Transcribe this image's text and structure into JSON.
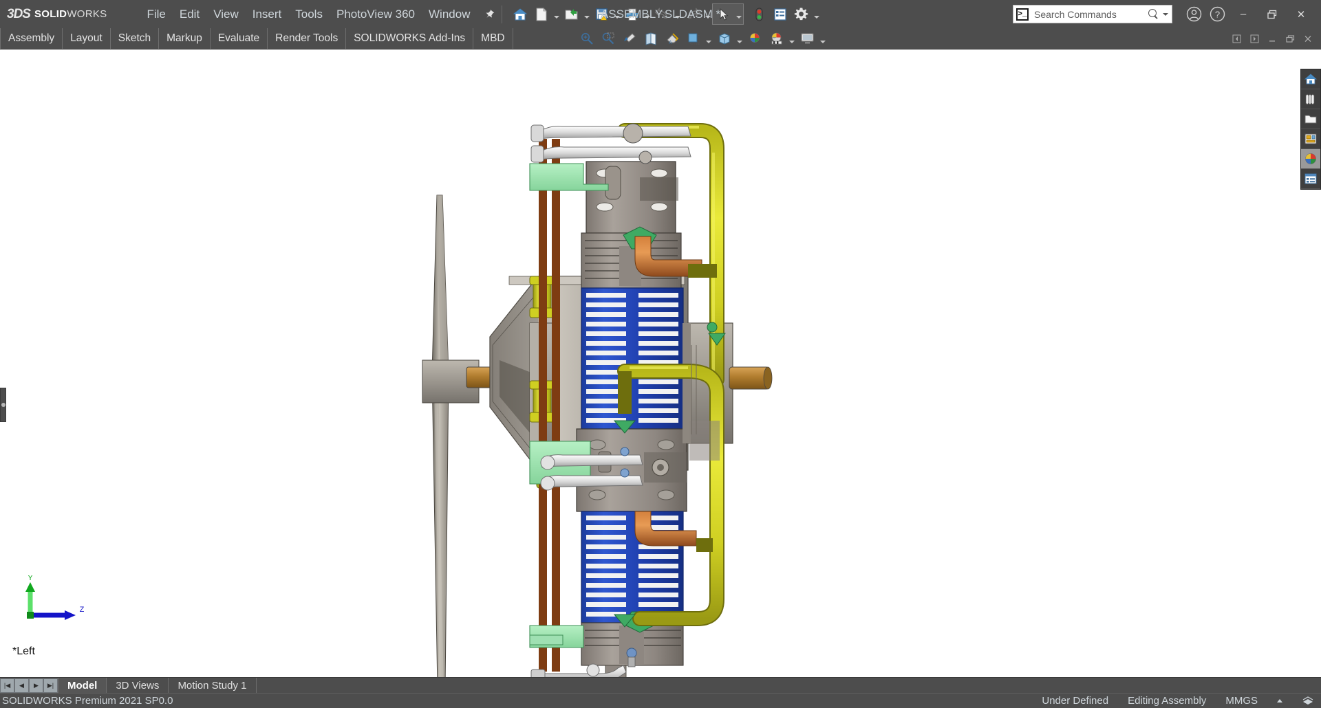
{
  "app": {
    "brand_ds": "3DS",
    "brand_name_bold": "SOLID",
    "brand_name_thin": "WORKS",
    "document_title": "ASSEMBLY.SLDASM *"
  },
  "menu": {
    "items": [
      {
        "label": "File",
        "name": "menu-file"
      },
      {
        "label": "Edit",
        "name": "menu-edit"
      },
      {
        "label": "View",
        "name": "menu-view"
      },
      {
        "label": "Insert",
        "name": "menu-insert"
      },
      {
        "label": "Tools",
        "name": "menu-tools"
      },
      {
        "label": "PhotoView 360",
        "name": "menu-photoview-360"
      },
      {
        "label": "Window",
        "name": "menu-window"
      }
    ],
    "pin_icon": "pin-icon"
  },
  "quick_toolbar": {
    "icons": [
      "home-icon",
      "new-document-icon",
      "open-folder-icon",
      "save-warning-icon",
      "print-icon",
      "undo-icon",
      "redo-icon",
      "select-arrow-icon",
      "rebuild-icon",
      "options-list-icon",
      "settings-gear-icon"
    ]
  },
  "search": {
    "placeholder": "Search Commands",
    "value": "",
    "icon": "search-commands-icon"
  },
  "title_actions": {
    "account_icon": "user-account-icon",
    "help_icon": "help-question-icon",
    "minimize": "–",
    "restore": "restore-window-icon",
    "close": "✕"
  },
  "ribbon": {
    "tabs": [
      {
        "label": "Assembly",
        "name": "tab-assembly"
      },
      {
        "label": "Layout",
        "name": "tab-layout"
      },
      {
        "label": "Sketch",
        "name": "tab-sketch"
      },
      {
        "label": "Markup",
        "name": "tab-markup"
      },
      {
        "label": "Evaluate",
        "name": "tab-evaluate"
      },
      {
        "label": "Render Tools",
        "name": "tab-render-tools"
      },
      {
        "label": "SOLIDWORKS Add-Ins",
        "name": "tab-solidworks-add-ins"
      },
      {
        "label": "MBD",
        "name": "tab-mbd"
      }
    ],
    "view_tools": [
      "zoom-to-fit-icon",
      "zoom-to-area-icon",
      "zoom-to-selection-icon",
      "section-view-icon",
      "view-orientation-icon",
      "display-style-icon",
      "hide-show-icon",
      "edit-appearance-icon",
      "apply-scene-icon",
      "view-settings-icon"
    ],
    "doc_window_buttons": [
      "prev-doc-icon",
      "next-doc-icon",
      "minimize-doc-icon",
      "restore-doc-icon",
      "close-doc-icon"
    ]
  },
  "graphics": {
    "view_label": "*Left",
    "triad": {
      "y_axis": "Y",
      "z_axis": "Z"
    },
    "panel_handle": "feature-manager-handle",
    "background_color": "#ffffff"
  },
  "task_pane": {
    "items": [
      {
        "name": "task-pane-resources-icon",
        "active": false
      },
      {
        "name": "task-pane-design-library-icon",
        "active": false
      },
      {
        "name": "task-pane-file-explorer-icon",
        "active": false
      },
      {
        "name": "task-pane-view-palette-icon",
        "active": false
      },
      {
        "name": "task-pane-appearances-icon",
        "active": true
      },
      {
        "name": "task-pane-custom-properties-icon",
        "active": false
      }
    ]
  },
  "bottom_tabs": {
    "nav_buttons": [
      "first-config-button",
      "prev-config-button",
      "next-config-button",
      "last-config-button"
    ],
    "tabs": [
      {
        "label": "Model",
        "name": "bottom-tab-model",
        "active": true
      },
      {
        "label": "3D Views",
        "name": "bottom-tab-3d-views",
        "active": false
      },
      {
        "label": "Motion Study 1",
        "name": "bottom-tab-motion-study-1",
        "active": false
      }
    ]
  },
  "status_bar": {
    "version": "SOLIDWORKS Premium 2021 SP0.0",
    "sketch_state": "Under Defined",
    "edit_mode": "Editing Assembly",
    "units": "MMGS",
    "units_caret": "units-dropdown-caret",
    "overlay_icon": "rebuild-overlay-icon"
  },
  "colors": {
    "chrome": "#4d4d4d",
    "chrome_text": "#cfd6db",
    "accent_blue": "#2b4db5",
    "accent_yellow": "#d6d622",
    "accent_copper": "#c87137",
    "accent_green": "#99e0a8",
    "metal_grey": "#9c9790"
  }
}
